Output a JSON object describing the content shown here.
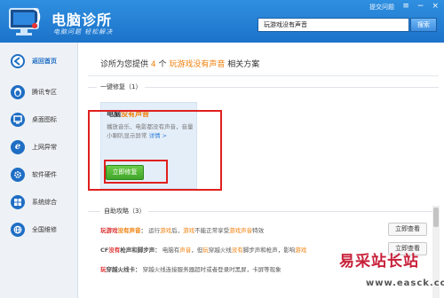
{
  "header": {
    "title": "电脑诊所",
    "slogan": "电脑问题  轻松解决",
    "feedback": "提交问题",
    "window_buttons": [
      "≡",
      "−",
      "×"
    ],
    "search_value": "玩游戏没有声音",
    "search_button": "搜索"
  },
  "sidebar": {
    "items": [
      {
        "label": "返回首页",
        "icon": "back-arrow-icon",
        "glyph": "←"
      },
      {
        "label": "腾讯专区",
        "icon": "qq-penguin-icon",
        "glyph": "●"
      },
      {
        "label": "桌面图标",
        "icon": "monitor-icon",
        "glyph": "▭"
      },
      {
        "label": "上网异常",
        "icon": "ie-browser-icon",
        "glyph": "e"
      },
      {
        "label": "软件硬件",
        "icon": "gear-icon",
        "glyph": "✲"
      },
      {
        "label": "系统综合",
        "icon": "windows-icon",
        "glyph": "⊞"
      },
      {
        "label": "全国维修",
        "icon": "globe-icon",
        "glyph": "◍"
      }
    ]
  },
  "main": {
    "headline_prefix": "诊所为您提供",
    "headline_count": "4",
    "headline_unit": "个",
    "headline_topic": "玩游戏没有声音",
    "headline_suffix": "相关方案",
    "one_click": {
      "section_title": "一键修复（1）",
      "card_title_a": "电脑",
      "card_title_b": "没有声音",
      "card_desc": "播放音乐、电影都没有声音，音量小喇叭显示异常",
      "card_link": "详情 >",
      "button": "立即修复"
    },
    "self_help": {
      "section_title": "自助攻略（3）",
      "rows": [
        {
          "title_a": "玩游戏",
          "title_b": "没有声音",
          "title_c": "：",
          "desc_1": "运行",
          "desc_2": "游戏",
          "desc_3": "后，",
          "desc_4": "游戏",
          "desc_5": "不能正常享受",
          "desc_6": "游戏声音",
          "desc_7": "特效",
          "button": "立即查看"
        },
        {
          "title_a": "CF",
          "title_b": "没有",
          "title_c": "枪声和脚步声：",
          "desc_1": "电脑有",
          "desc_2": "声音",
          "desc_3": "，但",
          "desc_4": "玩",
          "desc_5": "穿越火线",
          "desc_6": "没有",
          "desc_7": "脚步声和枪声，影响",
          "desc_8": "游戏",
          "button": "立即查看"
        },
        {
          "title_a": "玩",
          "title_b": "穿越火线卡",
          "title_c": "：",
          "desc_1": "穿越火线连接服务器超时或者登录时黑屏，卡屏等现象"
        }
      ]
    }
  },
  "watermark": {
    "cn": "易采站长站",
    "en": "www.easck.com"
  }
}
